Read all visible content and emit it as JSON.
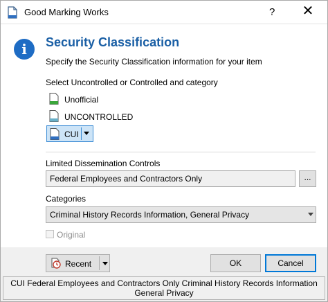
{
  "window": {
    "title": "Good Marking Works",
    "help_glyph": "?",
    "close_glyph": "✕"
  },
  "header": {
    "heading": "Security Classification",
    "subtext": "Specify the Security Classification information for your item",
    "info_glyph": "i",
    "icon": "info-icon"
  },
  "classification": {
    "prompt": "Select Uncontrolled or Controlled and category",
    "options": [
      {
        "label": "Unofficial",
        "icon": "document-green-icon",
        "selected": false
      },
      {
        "label": "UNCONTROLLED",
        "icon": "document-teal-icon",
        "selected": false
      },
      {
        "label": "CUI",
        "icon": "document-blue-icon",
        "selected": true
      }
    ]
  },
  "ldc": {
    "label": "Limited Dissemination Controls",
    "value": "Federal Employees and Contractors Only",
    "browse_label": "..."
  },
  "categories": {
    "label": "Categories",
    "selected": "Criminal History Records Information, General Privacy"
  },
  "original": {
    "label": "Original",
    "checked": false,
    "enabled": false
  },
  "buttons": {
    "recent": "Recent",
    "ok": "OK",
    "cancel": "Cancel"
  },
  "status": {
    "line1": "CUI Federal Employees and Contractors Only Criminal History Records Information",
    "line2": "General Privacy"
  },
  "colors": {
    "heading": "#1a5fa5",
    "info_icon": "#1e6cc4",
    "selection": "#cde4f7",
    "focus_border": "#0078d7"
  }
}
